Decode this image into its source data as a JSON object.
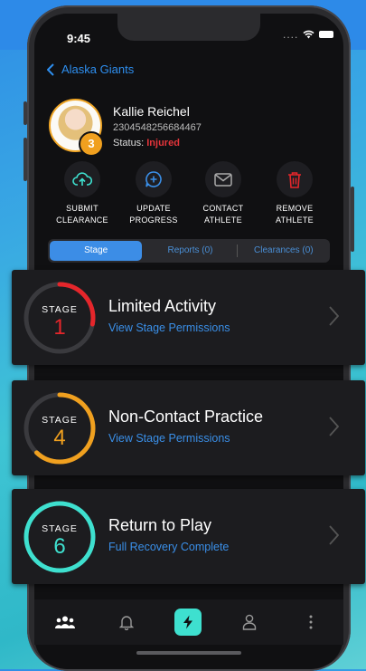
{
  "status_bar": {
    "time": "9:45",
    "dots": "...."
  },
  "nav": {
    "back_label": "Alaska Giants"
  },
  "athlete": {
    "name": "Kallie Reichel",
    "id": "2304548256684467",
    "status_label": "Status:",
    "status_value": "Injured",
    "stage_badge": "3"
  },
  "actions": [
    {
      "label1": "SUBMIT",
      "label2": "CLEARANCE",
      "icon": "cloud-upload-icon"
    },
    {
      "label1": "UPDATE",
      "label2": "PROGRESS",
      "icon": "chat-plus-icon"
    },
    {
      "label1": "CONTACT",
      "label2": "ATHLETE",
      "icon": "mail-icon"
    },
    {
      "label1": "REMOVE",
      "label2": "ATHLETE",
      "icon": "trash-icon"
    }
  ],
  "tabs": [
    {
      "label": "Stage",
      "active": true
    },
    {
      "label": "Reports (0)",
      "active": false
    },
    {
      "label": "Clearances (0)",
      "active": false
    }
  ],
  "stages": [
    {
      "stage_word": "STAGE",
      "number": "1",
      "title": "Limited Activity",
      "link": "View Stage Permissions",
      "color": "#e5262b",
      "progress": 0.28
    },
    {
      "stage_word": "STAGE",
      "number": "4",
      "title": "Non-Contact Practice",
      "link": "View Stage Permissions",
      "color": "#f0a01f",
      "progress": 0.62
    },
    {
      "stage_word": "STAGE",
      "number": "6",
      "title": "Return to Play",
      "link": "Full Recovery Complete",
      "color": "#3ee0cf",
      "progress": 1.0
    }
  ],
  "bottom_nav": [
    {
      "icon": "team-icon",
      "active": true
    },
    {
      "icon": "bell-icon",
      "active": false
    },
    {
      "icon": "lightning-icon",
      "active": false,
      "highlight": "#3ee0cf"
    },
    {
      "icon": "profile-icon",
      "active": false
    },
    {
      "icon": "more-vertical-icon",
      "active": false
    }
  ]
}
